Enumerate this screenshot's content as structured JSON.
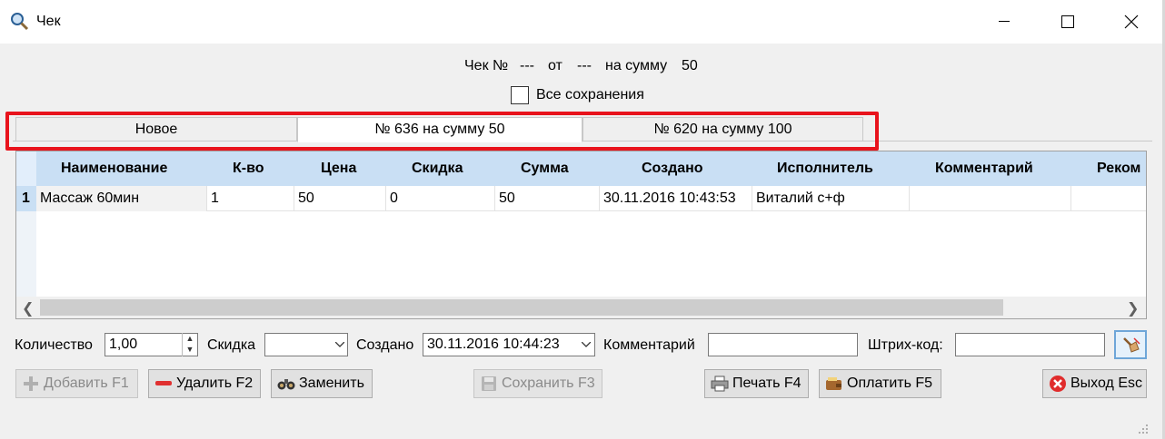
{
  "window": {
    "title": "Чек"
  },
  "header": {
    "check_label": "Чек №",
    "check_number": "---",
    "from_label": "от",
    "date": "---",
    "sum_label": "на сумму",
    "sum": "50",
    "all_saves_label": "Все сохранения"
  },
  "tabs": [
    {
      "label": "Новое"
    },
    {
      "label": "№ 636 на сумму 50"
    },
    {
      "label": "№ 620 на сумму 100"
    }
  ],
  "table": {
    "columns": [
      "Наименование",
      "К-во",
      "Цена",
      "Скидка",
      "Сумма",
      "Создано",
      "Исполнитель",
      "Комментарий",
      "Реком"
    ],
    "rows": [
      {
        "num": "1",
        "cells": [
          "Массаж 60мин",
          "1",
          "50",
          "0",
          "50",
          "30.11.2016 10:43:53",
          "Виталий с+ф",
          "",
          ""
        ]
      }
    ]
  },
  "form": {
    "quantity_label": "Количество",
    "quantity_value": "1,00",
    "discount_label": "Скидка",
    "discount_value": "",
    "created_label": "Создано",
    "created_value": "30.11.2016 10:44:23",
    "comment_label": "Комментарий",
    "comment_value": "",
    "barcode_label": "Штрих-код:",
    "barcode_value": ""
  },
  "buttons": {
    "add": "Добавить F1",
    "delete": "Удалить F2",
    "replace": "Заменить",
    "save": "Сохранить F3",
    "print": "Печать F4",
    "pay": "Оплатить F5",
    "exit": "Выход Esc"
  },
  "colors": {
    "highlight": "#e8131c",
    "grid_header": "#c9dff4"
  }
}
